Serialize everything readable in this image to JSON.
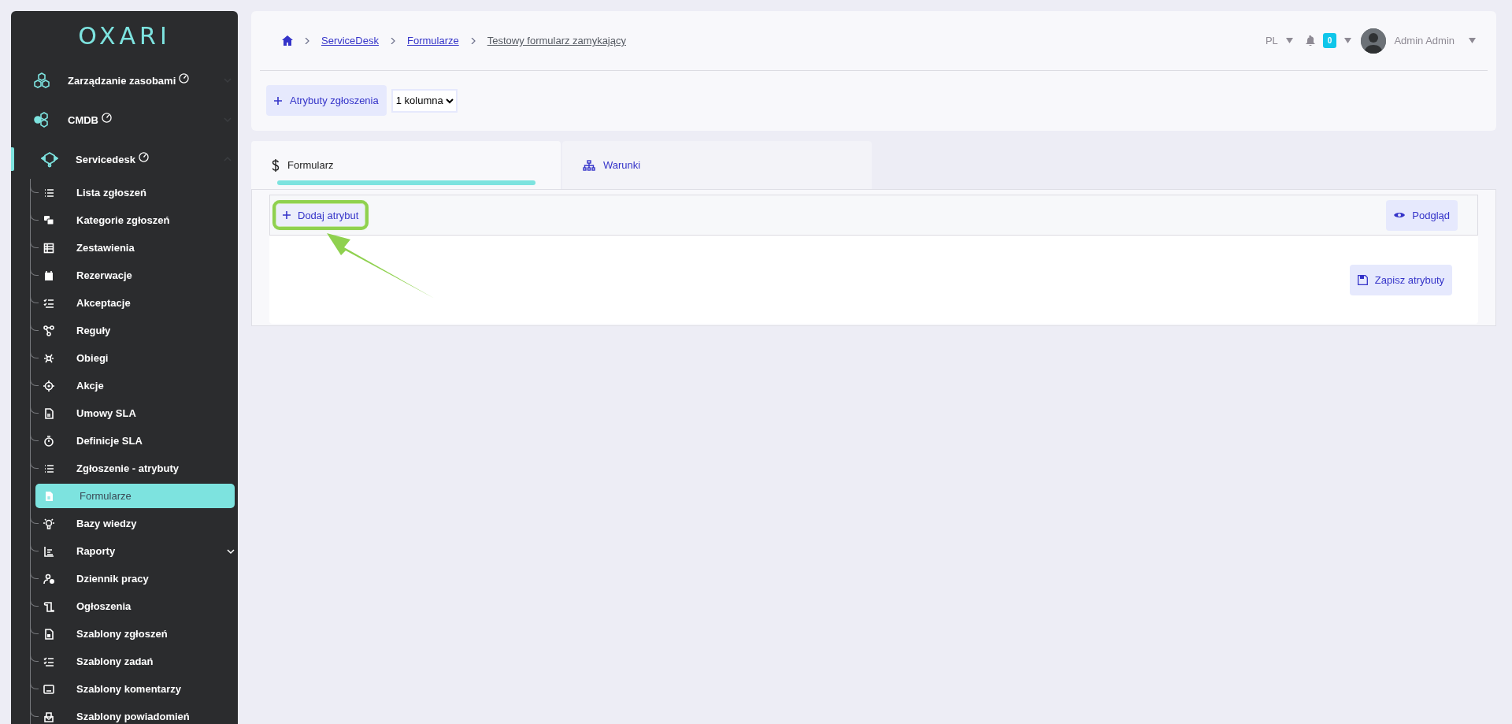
{
  "sidebar": {
    "logo": "OXARI",
    "modules": [
      {
        "label": "Zarządzanie zasobami",
        "expanded": false
      },
      {
        "label": "CMDB",
        "expanded": false
      },
      {
        "label": "Servicedesk",
        "expanded": true,
        "children": [
          {
            "label": "Lista zgłoszeń",
            "kind": "link",
            "selected": false
          },
          {
            "label": "Kategorie zgłoszeń",
            "kind": "link",
            "selected": false
          },
          {
            "label": "Zestawienia",
            "kind": "link",
            "selected": false
          },
          {
            "label": "Rezerwacje",
            "kind": "link",
            "selected": false
          },
          {
            "label": "Akceptacje",
            "kind": "link",
            "selected": false
          },
          {
            "label": "Reguły",
            "kind": "link",
            "selected": false
          },
          {
            "label": "Obiegi",
            "kind": "link",
            "selected": false
          },
          {
            "label": "Akcje",
            "kind": "link",
            "selected": false
          },
          {
            "label": "Umowy SLA",
            "kind": "link",
            "selected": false
          },
          {
            "label": "Definicje SLA",
            "kind": "link",
            "selected": false
          },
          {
            "label": "Zgłoszenie - atrybuty",
            "kind": "link",
            "selected": false
          },
          {
            "label": "Formularze",
            "kind": "link",
            "selected": true
          },
          {
            "label": "Bazy wiedzy",
            "kind": "link",
            "selected": false
          },
          {
            "label": "Raporty",
            "kind": "group",
            "selected": false
          },
          {
            "label": "Dziennik pracy",
            "kind": "link",
            "selected": false
          },
          {
            "label": "Ogłoszenia",
            "kind": "link",
            "selected": false
          },
          {
            "label": "Szablony zgłoszeń",
            "kind": "link",
            "selected": false
          },
          {
            "label": "Szablony zadań",
            "kind": "link",
            "selected": false
          },
          {
            "label": "Szablony komentarzy",
            "kind": "link",
            "selected": false
          },
          {
            "label": "Szablony powiadomień",
            "kind": "link",
            "selected": false
          }
        ]
      }
    ]
  },
  "header": {
    "breadcrumb": [
      {
        "label": "ServiceDesk",
        "kind": "link"
      },
      {
        "label": "Formularze",
        "kind": "link"
      },
      {
        "label": "Testowy formularz zamykający",
        "kind": "current"
      }
    ],
    "language": "PL",
    "notifications": "0",
    "user": "Admin Admin",
    "add_button": "Atrybuty zgłoszenia",
    "columns_select": "1 kolumna"
  },
  "tabs": [
    {
      "label": "Formularz",
      "selected": true
    },
    {
      "label": "Warunki",
      "selected": false
    }
  ],
  "panel": {
    "add_attribute": "Dodaj atrybut",
    "highlighted": true,
    "preview": "Podgląd",
    "save": "Zapisz atrybuty"
  }
}
